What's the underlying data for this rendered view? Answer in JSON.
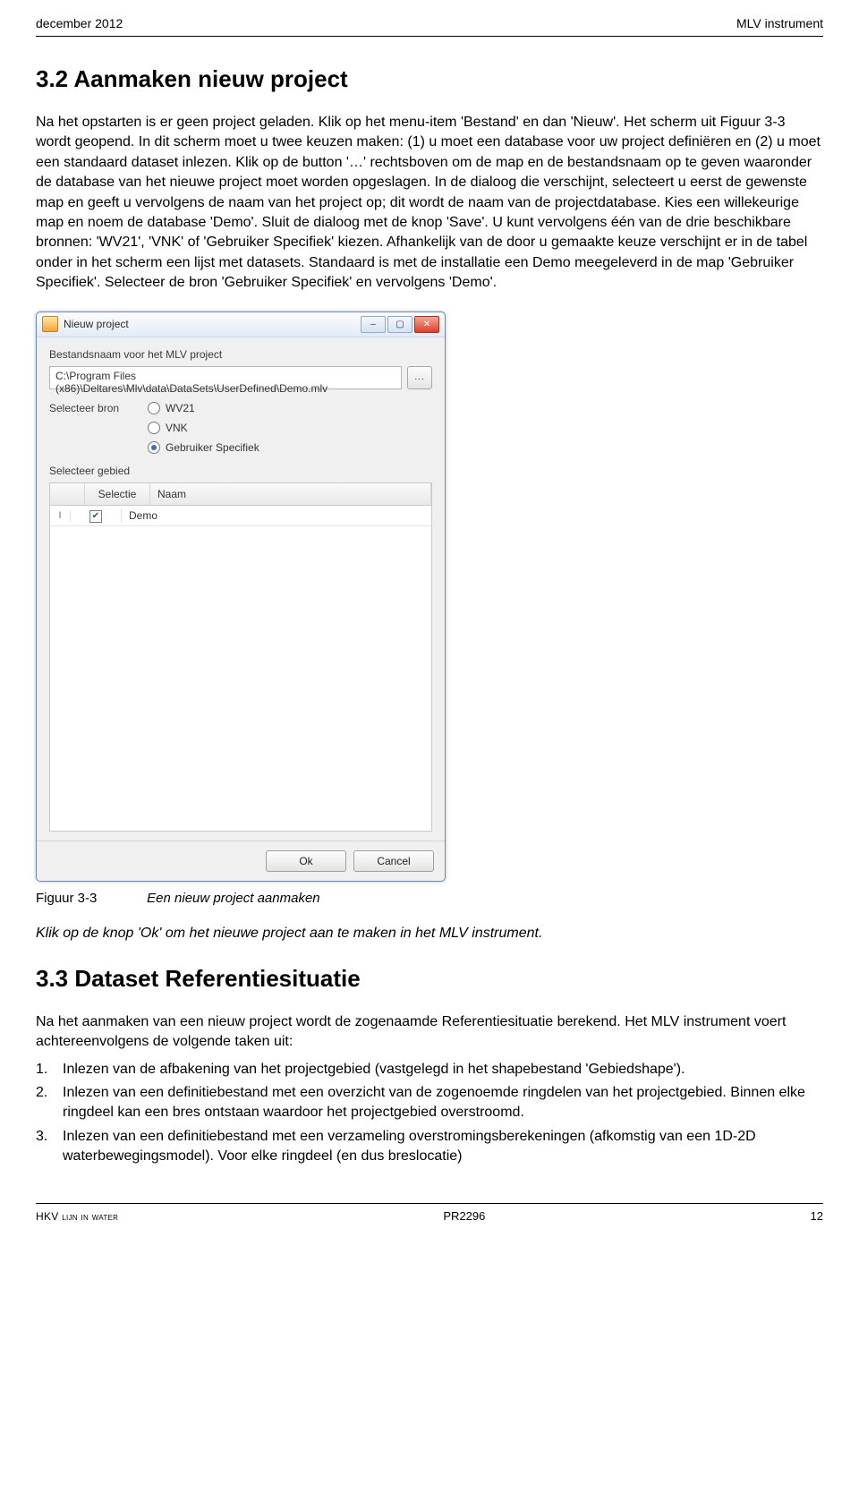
{
  "header": {
    "left": "december 2012",
    "right": "MLV instrument"
  },
  "sections": {
    "s32_title": "3.2 Aanmaken nieuw project",
    "s32_body": "Na het opstarten is er geen project geladen. Klik op het menu-item 'Bestand' en dan 'Nieuw'. Het scherm uit Figuur 3-3 wordt geopend. In dit scherm moet u twee keuzen maken: (1) u moet een database voor uw project definiëren en (2) u moet een standaard dataset inlezen. Klik op de button '…' rechtsboven om de map en de bestandsnaam op te geven waaronder de database van het nieuwe project moet worden opgeslagen. In de dialoog die verschijnt, selecteert u eerst de gewenste map en geeft u vervolgens de naam van het project op; dit wordt de naam van de projectdatabase. Kies een willekeurige map en noem de database 'Demo'. Sluit de dialoog met de knop 'Save'. U kunt vervolgens één van de drie beschikbare bronnen: 'WV21', 'VNK' of 'Gebruiker Specifiek' kiezen. Afhankelijk van de door u gemaakte keuze verschijnt er in de tabel onder in het scherm een lijst met datasets. Standaard is met de installatie een Demo meegeleverd in de map 'Gebruiker Specifiek'. Selecteer de bron 'Gebruiker Specifiek' en vervolgens 'Demo'.",
    "fig_label": "Figuur 3-3",
    "fig_caption": "Een nieuw project aanmaken",
    "after_fig": "Klik op de knop 'Ok' om het nieuwe project aan te maken in het MLV instrument.",
    "s33_title": "3.3 Dataset Referentiesituatie",
    "s33_intro": "Na het aanmaken van een nieuw project wordt de zogenaamde Referentiesituatie berekend. Het MLV instrument voert achtereenvolgens de volgende taken uit:",
    "s33_items": [
      "Inlezen van de afbakening van het projectgebied (vastgelegd in het shapebestand 'Gebiedshape').",
      "Inlezen van een definitiebestand met een overzicht van de zogenoemde ringdelen van het projectgebied. Binnen elke ringdeel kan een bres ontstaan waardoor het projectgebied overstroomd.",
      "Inlezen van een definitiebestand met een verzameling overstromingsberekeningen (afkomstig van een 1D-2D waterbewegingsmodel). Voor elke ringdeel (en dus breslocatie)"
    ]
  },
  "dialog": {
    "title": "Nieuw project",
    "group1": "Bestandsnaam voor het MLV project",
    "path": "C:\\Program Files (x86)\\Deltares\\Mlv\\data\\DataSets\\UserDefined\\Demo.mlv",
    "browse": "...",
    "label_bron": "Selecteer bron",
    "radios": [
      "WV21",
      "VNK",
      "Gebruiker Specifiek"
    ],
    "label_gebied": "Selecteer gebied",
    "th_sel": "Selectie",
    "th_name": "Naam",
    "row_marker": "I",
    "row_name": "Demo",
    "ok": "Ok",
    "cancel": "Cancel"
  },
  "footer": {
    "left": "HKV LIJN IN WATER",
    "center": "PR2296",
    "right": "12"
  }
}
